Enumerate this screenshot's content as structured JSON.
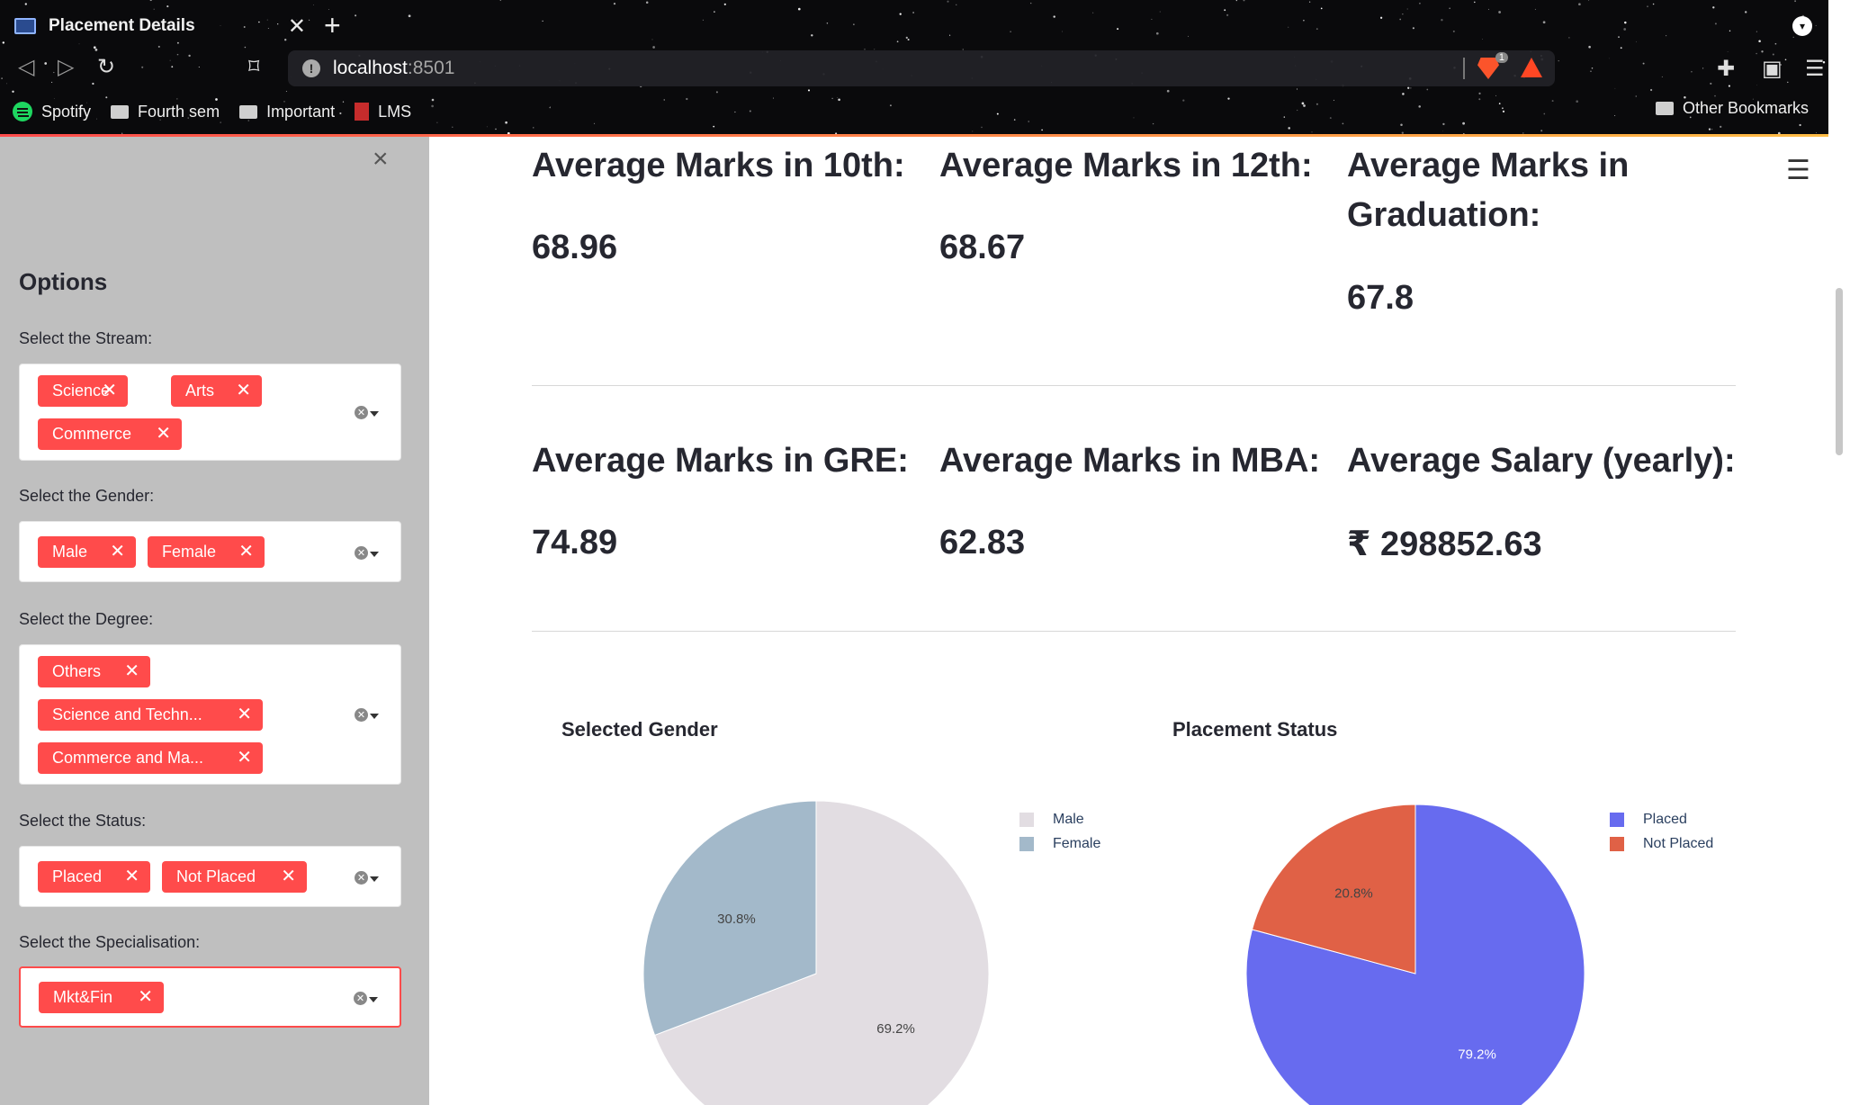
{
  "browser": {
    "tab_title": "Placement Details",
    "url_host": "localhost",
    "url_port": ":8501",
    "brave_badge": "1",
    "bookmarks": [
      "Spotify",
      "Fourth sem",
      "Important",
      "LMS"
    ],
    "other_bookmarks": "Other Bookmarks"
  },
  "sidebar": {
    "title": "Options",
    "stream": {
      "label": "Select the Stream:",
      "tags": [
        "Science",
        "Arts",
        "Commerce"
      ]
    },
    "gender": {
      "label": "Select the Gender:",
      "tags": [
        "Male",
        "Female"
      ]
    },
    "degree": {
      "label": "Select the Degree:",
      "tags": [
        "Others",
        "Science and Techn...",
        "Commerce and Ma..."
      ]
    },
    "status": {
      "label": "Select the Status:",
      "tags": [
        "Placed",
        "Not Placed"
      ]
    },
    "specialisation": {
      "label": "Select the Specialisation:",
      "tags": [
        "Mkt&Fin"
      ]
    }
  },
  "metrics": {
    "avg10": {
      "label": "Average Marks in 10th:",
      "value": "68.96"
    },
    "avg12": {
      "label": "Average Marks in 12th:",
      "value": "68.67"
    },
    "avgGrad": {
      "label": "Average Marks in Graduation:",
      "value": "67.8"
    },
    "avgGre": {
      "label": "Average Marks in GRE:",
      "value": "74.89"
    },
    "avgMba": {
      "label": "Average Marks in MBA:",
      "value": "62.83"
    },
    "avgSalary": {
      "label": "Average Salary (yearly):",
      "value": "₹ 298852.63"
    }
  },
  "chart_data": [
    {
      "type": "pie",
      "title": "Selected Gender",
      "labels": [
        "Male",
        "Female"
      ],
      "values": [
        69.2,
        30.8
      ],
      "value_labels": [
        "69.2%",
        "30.8%"
      ],
      "colors": [
        "#e2dde2",
        "#a3b9ca"
      ],
      "legend": "top-right"
    },
    {
      "type": "pie",
      "title": "Placement Status",
      "labels": [
        "Placed",
        "Not Placed"
      ],
      "values": [
        79.2,
        20.8
      ],
      "value_labels": [
        "79.2%",
        "20.8%"
      ],
      "colors": [
        "#676bef",
        "#e06146"
      ],
      "legend": "top-right"
    }
  ]
}
